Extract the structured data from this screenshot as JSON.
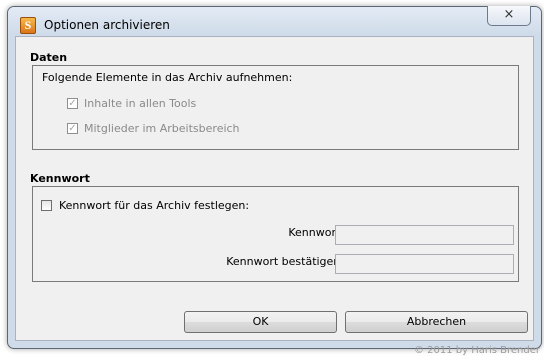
{
  "window": {
    "title": "Optionen archivieren",
    "close_glyph": "×"
  },
  "data_section": {
    "title": "Daten",
    "group_label": "Folgende Elemente in das Archiv aufnehmen:",
    "options": [
      {
        "label": "Inhalte in allen Tools",
        "checked": true,
        "enabled": false
      },
      {
        "label": "Mitglieder im Arbeitsbereich",
        "checked": true,
        "enabled": false
      }
    ]
  },
  "password_section": {
    "title": "Kennwort",
    "set_password_label": "Kennwort für das Archiv festlegen:",
    "set_password_checked": false,
    "password_label": "Kennwort:",
    "password_value": "",
    "confirm_label": "Kennwort bestätigen:",
    "confirm_value": ""
  },
  "buttons": {
    "ok": "OK",
    "cancel": "Abbrechen"
  },
  "watermark": "© 2011 by Haris Brender",
  "icons": {
    "app": "app-icon",
    "check": "✓"
  }
}
